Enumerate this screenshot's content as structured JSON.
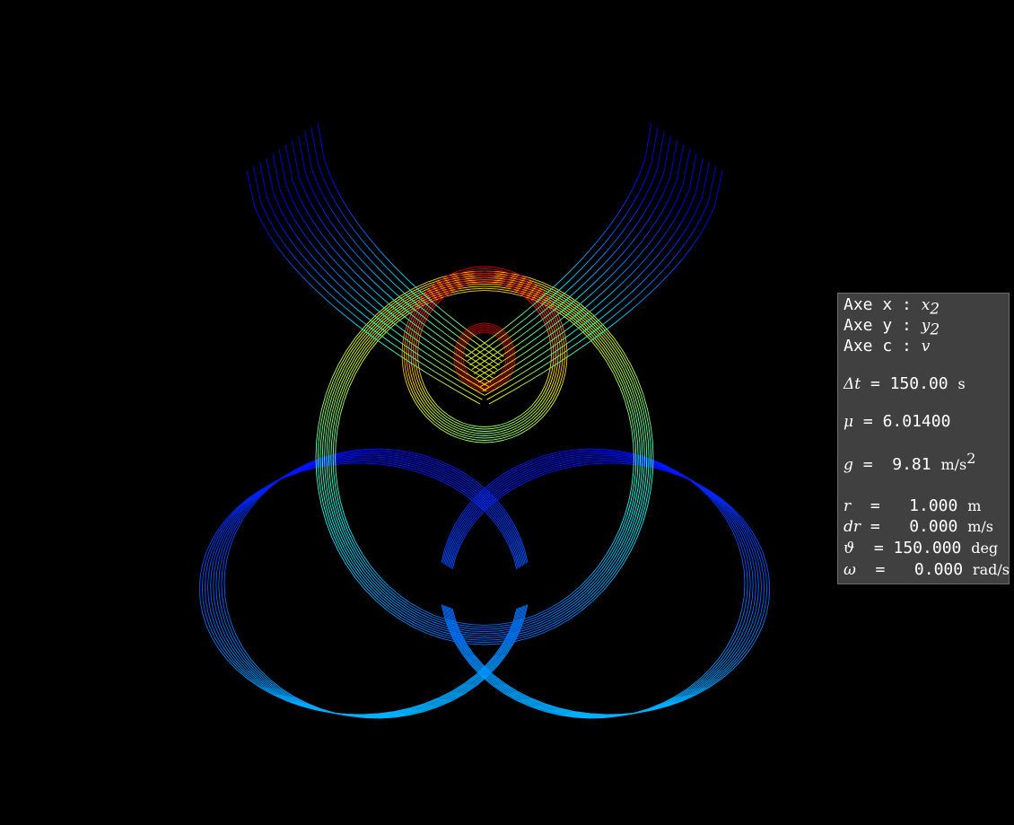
{
  "panel": {
    "axe_x_label": "Axe x : ",
    "axe_x_var": "x",
    "axe_x_sub": "2",
    "axe_y_label": "Axe y : ",
    "axe_y_var": "y",
    "axe_y_sub": "2",
    "axe_c_label": "Axe c : ",
    "axe_c_var": "v",
    "dt_sym": "Δt",
    "dt_value": " = 150.00 ",
    "dt_unit": "s",
    "mu_sym": "μ",
    "mu_value": " = 6.01400",
    "g_sym": "g",
    "g_value": " =  9.81 ",
    "g_unit": "m/s",
    "g_unit_sup": "2",
    "r_sym": "r",
    "r_value": "  =   1.000 ",
    "r_unit": "m",
    "dr_sym": "dr",
    "dr_value": " =   0.000 ",
    "dr_unit": "m/s",
    "theta_sym": "ϑ",
    "theta_value": "  = 150.000 ",
    "theta_unit": "deg",
    "omega_sym": "ω",
    "omega_value": "  =   0.000 ",
    "omega_unit": "rad/s"
  },
  "colors": {
    "background": "#000000",
    "panel_bg": "#404040",
    "colormap": "jet"
  }
}
